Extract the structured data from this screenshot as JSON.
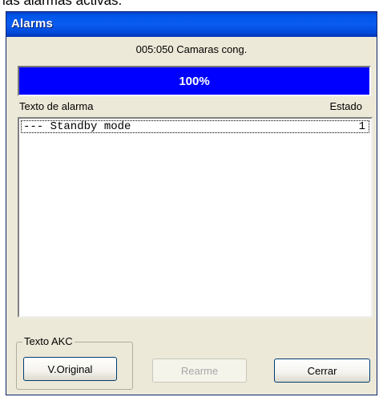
{
  "caption_cut": "las alarmas activas.",
  "window": {
    "title": "Alarms"
  },
  "header": {
    "text": "005:050  Camaras cong."
  },
  "progress": {
    "label": "100%",
    "value_percent": 100,
    "fill_color": "#0000ff"
  },
  "columns": {
    "alarm_text": "Texto de alarma",
    "state": "Estado"
  },
  "alarm_list": [
    {
      "text": "--- Standby mode",
      "state": "1"
    }
  ],
  "group": {
    "label": "Texto AKC"
  },
  "buttons": {
    "original": "V.Original",
    "reset": "Rearme",
    "close": "Cerrar"
  },
  "colors": {
    "titlebar": "#0a5cf0",
    "window_bg": "#ece9d8"
  }
}
